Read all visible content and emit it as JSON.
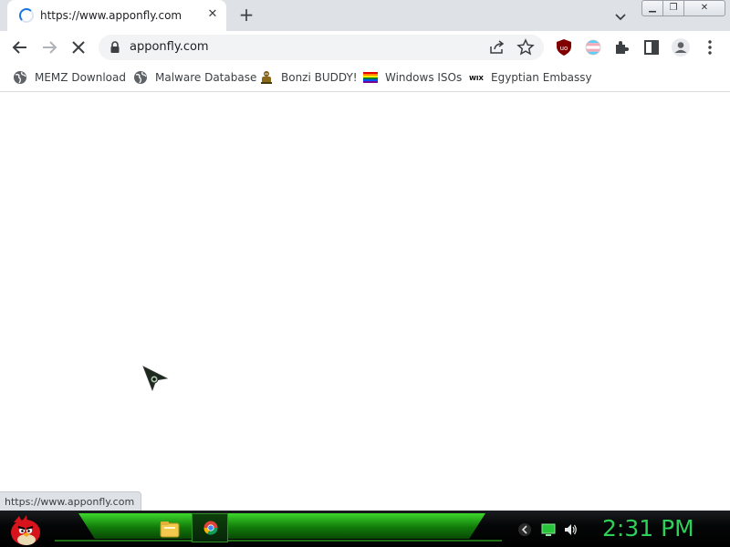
{
  "browser": {
    "tab": {
      "title": "https://www.apponfly.com",
      "loading": true
    },
    "omnibox": {
      "url": "apponfly.com"
    },
    "bookmarks": [
      {
        "label": "MEMZ Download",
        "icon": "globe-icon"
      },
      {
        "label": "Malware Database",
        "icon": "globe-icon"
      },
      {
        "label": "Bonzi BUDDY!",
        "icon": "bonzi-icon"
      },
      {
        "label": "Windows ISOs",
        "icon": "rainbow-flag-icon"
      },
      {
        "label": "Egyptian Embassy",
        "icon": "wix-icon"
      }
    ],
    "status_url": "https://www.apponfly.com"
  },
  "taskbar": {
    "clock": "2:31 PM",
    "pinned": [
      "file-explorer-icon",
      "chrome-icon"
    ],
    "tray": [
      "back-arrow-icon",
      "monitor-icon",
      "speaker-icon"
    ]
  },
  "colors": {
    "tab_strip": "#dee1e6",
    "taskbar_green": "#2fd05a",
    "accent_blue": "#1a73e8"
  }
}
